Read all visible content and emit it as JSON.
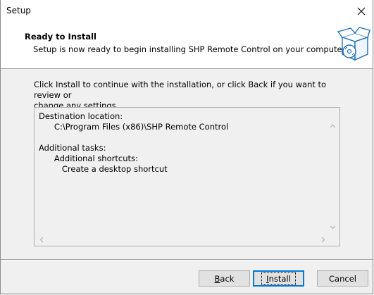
{
  "window": {
    "title": "Setup"
  },
  "header": {
    "heading": "Ready to Install",
    "subtext": "Setup is now ready to begin installing SHP Remote Control on your computer."
  },
  "body": {
    "instruction_line1": "Click Install to continue with the installation, or click Back if you want to review or",
    "instruction_line2": "change any settings."
  },
  "memo": {
    "lines": [
      "Destination location:",
      "      C:\\Program Files (x86)\\SHP Remote Control",
      "",
      "Additional tasks:",
      "      Additional shortcuts:",
      "         Create a desktop shortcut"
    ]
  },
  "buttons": {
    "back": {
      "label_accel": "B",
      "label_rest": "ack"
    },
    "install": {
      "label_accel": "I",
      "label_rest": "nstall"
    },
    "cancel": {
      "label": "Cancel"
    }
  },
  "icons": [
    "close-icon",
    "install-box-icon",
    "scroll-up-arrow-icon",
    "scroll-down-arrow-icon",
    "scroll-left-arrow-icon",
    "scroll-right-arrow-icon"
  ]
}
